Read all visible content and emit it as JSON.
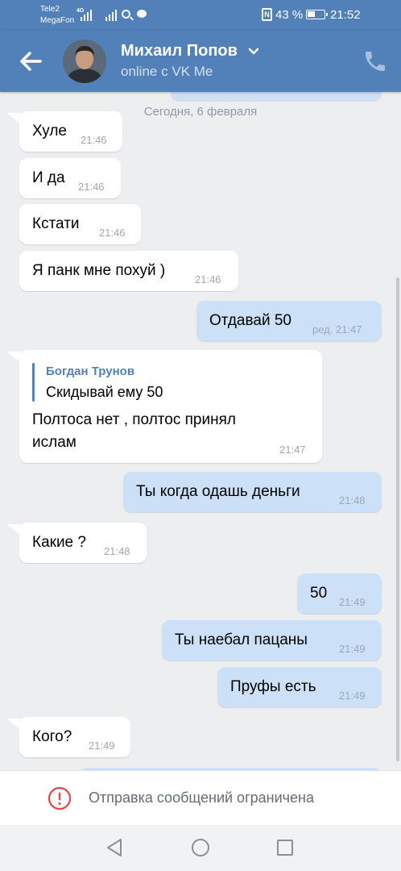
{
  "status_bar": {
    "carrier1": "Tele2",
    "carrier2": "MegaFon",
    "network_type": "4G",
    "battery_percent": "43 %",
    "time": "21:52",
    "nfc_label": "N"
  },
  "header": {
    "contact_name": "Михаил Попов",
    "status": "online с VK Me",
    "accent_color": "#5181b8"
  },
  "chat": {
    "date_separator": "Сегодня, 6 февраля",
    "messages": [
      {
        "direction": "in",
        "text": "Хуле",
        "time": "21:46"
      },
      {
        "direction": "in",
        "text": "И да",
        "time": "21:46"
      },
      {
        "direction": "in",
        "text": "Кстати",
        "time": "21:46"
      },
      {
        "direction": "in",
        "text": "Я панк мне похуй )",
        "time": "21:46"
      },
      {
        "direction": "out",
        "text": "Отдавай 50",
        "time": "ред. 21:47"
      },
      {
        "direction": "in",
        "reply_author": "Богдан Трунов",
        "reply_text": "Скидывай ему 50",
        "line1": "Полтоса нет , полтос принял",
        "line2": "ислам",
        "time": "21:47"
      },
      {
        "direction": "out",
        "text": "Ты когда одашь деньги",
        "time": "21:48"
      },
      {
        "direction": "in",
        "text": "Какие ?",
        "time": "21:48"
      },
      {
        "direction": "out",
        "text": "50",
        "time": "21:49"
      },
      {
        "direction": "out",
        "text": "Ты наебал пацаны",
        "time": "21:49"
      },
      {
        "direction": "out",
        "text": "Пруфы есть",
        "time": "21:49"
      },
      {
        "direction": "in",
        "text": "Кого?",
        "time": "21:49"
      }
    ]
  },
  "footer": {
    "restricted_text": "Отправка сообщений ограничена"
  },
  "icons": {
    "back": "arrow-left-icon",
    "call": "phone-icon",
    "warning": "exclamation-circle-icon",
    "nav": [
      "triangle-back-icon",
      "circle-home-icon",
      "square-recents-icon"
    ]
  }
}
